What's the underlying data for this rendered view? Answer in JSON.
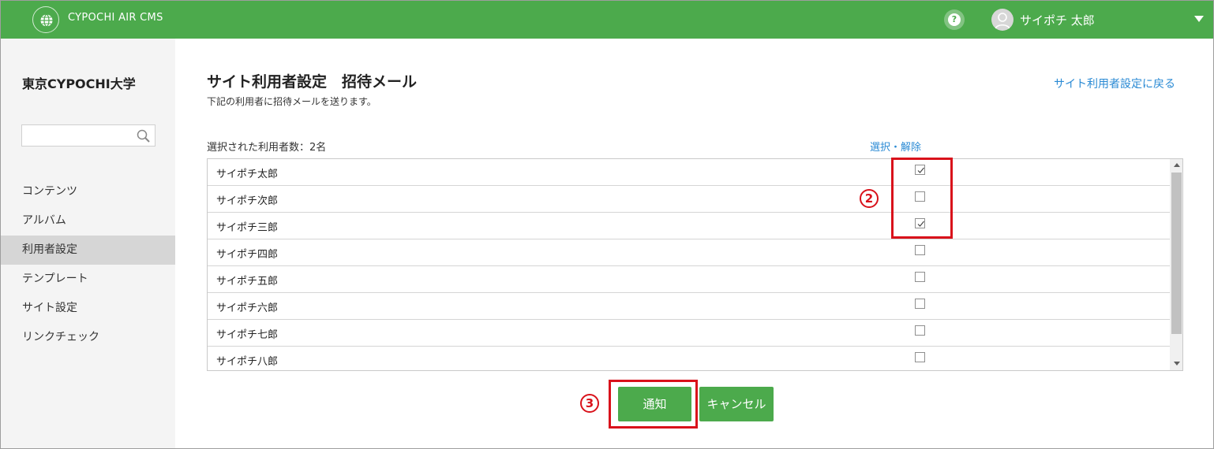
{
  "header": {
    "app_title": "CYPOCHI AIR CMS",
    "help_label": "?",
    "user_name": "サイポチ 太郎"
  },
  "sidebar": {
    "org_name": "東京CYPOCHI大学",
    "search": {
      "value": "",
      "placeholder": ""
    },
    "items": [
      {
        "label": "コンテンツ",
        "active": false
      },
      {
        "label": "アルバム",
        "active": false
      },
      {
        "label": "利用者設定",
        "active": true
      },
      {
        "label": "テンプレート",
        "active": false
      },
      {
        "label": "サイト設定",
        "active": false
      },
      {
        "label": "リンクチェック",
        "active": false
      }
    ]
  },
  "main": {
    "title": "サイト利用者設定　招待メール",
    "subtitle": "下記の利用者に招待メールを送ります。",
    "back_link": "サイト利用者設定に戻る",
    "selected_count": "選択された利用者数：2名",
    "toggle_link": "選択・解除",
    "users": [
      {
        "name": "サイポチ太郎",
        "checked": true
      },
      {
        "name": "サイポチ次郎",
        "checked": false
      },
      {
        "name": "サイポチ三郎",
        "checked": true
      },
      {
        "name": "サイポチ四郎",
        "checked": false
      },
      {
        "name": "サイポチ五郎",
        "checked": false
      },
      {
        "name": "サイポチ六郎",
        "checked": false
      },
      {
        "name": "サイポチ七郎",
        "checked": false
      },
      {
        "name": "サイポチ八郎",
        "checked": false
      }
    ],
    "notify_button": "通知",
    "cancel_button": "キャンセル"
  },
  "annotations": {
    "marker_2": "2",
    "marker_3": "3"
  },
  "colors": {
    "brand_green": "#4caa4c",
    "link_blue": "#2a8ad4",
    "annotation_red": "#d9121b"
  }
}
